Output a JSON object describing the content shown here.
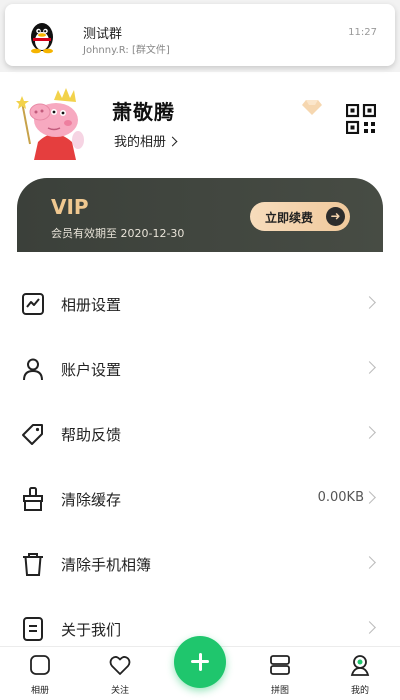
{
  "notification": {
    "title": "测试群",
    "message": "Johnny.R: [群文件]",
    "time": "11:27",
    "app_icon": "qq-penguin-icon"
  },
  "profile": {
    "name": "萧敬腾",
    "album_link": "我的相册",
    "avatar": "peppa-pig-queen-avatar",
    "badge_icon": "diamond-icon",
    "qr_icon": "qr-code-icon"
  },
  "vip": {
    "title": "VIP",
    "expiry": "会员有效期至 2020-12-30",
    "renew_label": "立即续费",
    "colors": {
      "card": "#3b403a",
      "title": "#f0c890",
      "button": "#f4d4b0"
    }
  },
  "menu": [
    {
      "label": "相册设置",
      "icon": "chart-frame-icon",
      "value": ""
    },
    {
      "label": "账户设置",
      "icon": "person-icon",
      "value": ""
    },
    {
      "label": "帮助反馈",
      "icon": "tag-icon",
      "value": ""
    },
    {
      "label": "清除缓存",
      "icon": "brush-icon",
      "value": "0.00KB"
    },
    {
      "label": "清除手机相簿",
      "icon": "trash-icon",
      "value": ""
    },
    {
      "label": "关于我们",
      "icon": "document-icon",
      "value": ""
    }
  ],
  "tabbar": {
    "tabs": [
      {
        "label": "相册",
        "icon": "album-icon",
        "active": false
      },
      {
        "label": "关注",
        "icon": "heart-icon",
        "active": false
      },
      {
        "label": "拼图",
        "icon": "collage-icon",
        "active": false
      },
      {
        "label": "我的",
        "icon": "profile-icon",
        "active": true
      }
    ],
    "fab_icon": "plus-icon",
    "accent": "#1fc66d"
  }
}
